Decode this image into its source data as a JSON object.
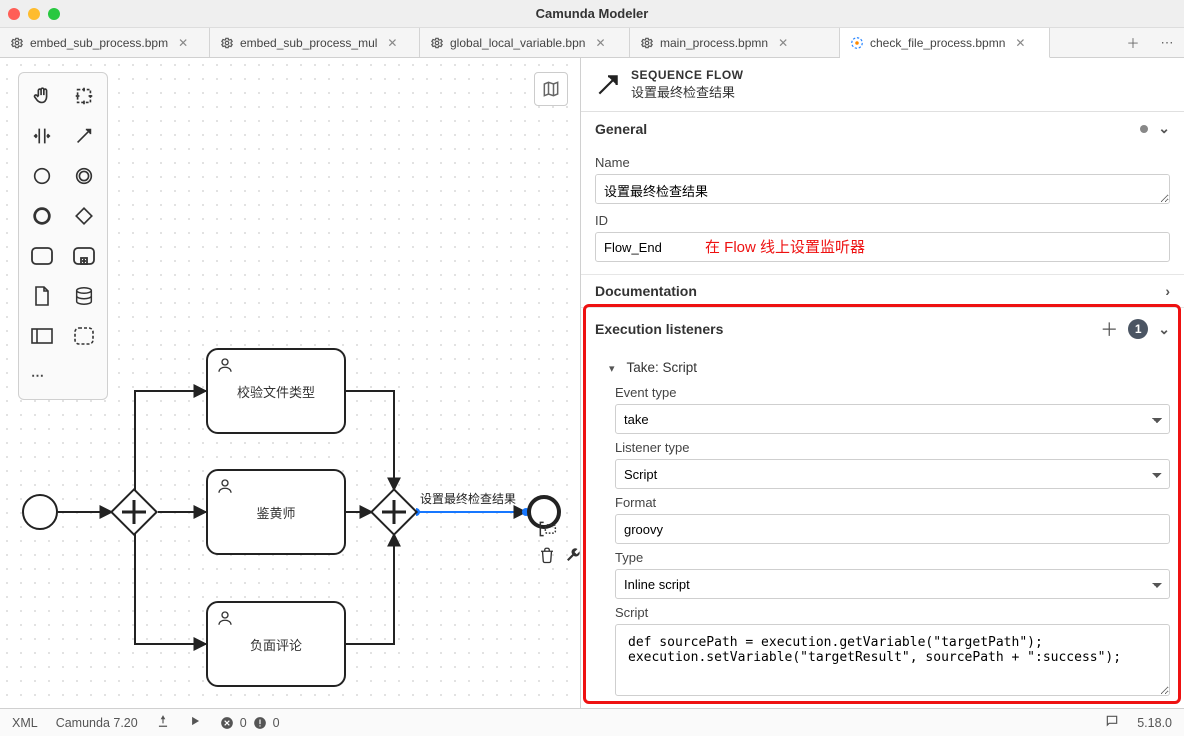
{
  "window": {
    "title": "Camunda Modeler"
  },
  "tabs": [
    {
      "label": "embed_sub_process.bpm",
      "icon": "gear",
      "active": false
    },
    {
      "label": "embed_sub_process_mul",
      "icon": "gear",
      "active": false
    },
    {
      "label": "global_local_variable.bpn",
      "icon": "gear",
      "active": false
    },
    {
      "label": "main_process.bpmn",
      "icon": "gear",
      "active": false
    },
    {
      "label": "check_file_process.bpmn",
      "icon": "camunda",
      "active": true
    }
  ],
  "canvas": {
    "tasks": {
      "top": "校验文件类型",
      "mid": "鉴黄师",
      "bot": "负面评论"
    },
    "flow_label": "设置最终检查结果"
  },
  "panel": {
    "type_label": "SEQUENCE FLOW",
    "subtitle": "设置最终检查结果",
    "sections": {
      "general": {
        "title": "General",
        "name_label": "Name",
        "name_value": "设置最终检查结果",
        "id_label": "ID",
        "id_value": "Flow_End"
      },
      "documentation": {
        "title": "Documentation"
      },
      "exec": {
        "title": "Execution listeners",
        "count": "1",
        "item_title": "Take: Script",
        "event_type_label": "Event type",
        "event_type_value": "take",
        "listener_type_label": "Listener type",
        "listener_type_value": "Script",
        "format_label": "Format",
        "format_value": "groovy",
        "type_label": "Type",
        "type_value": "Inline script",
        "script_label": "Script",
        "script_value": "def sourcePath = execution.getVariable(\"targetPath\");\nexecution.setVariable(\"targetResult\", sourcePath + \":success\");"
      }
    },
    "annotation": "在 Flow 线上设置监听器"
  },
  "status": {
    "left1": "XML",
    "left2": "Camunda 7.20",
    "err_count": "0",
    "warn_count": "0",
    "version": "5.18.0"
  }
}
